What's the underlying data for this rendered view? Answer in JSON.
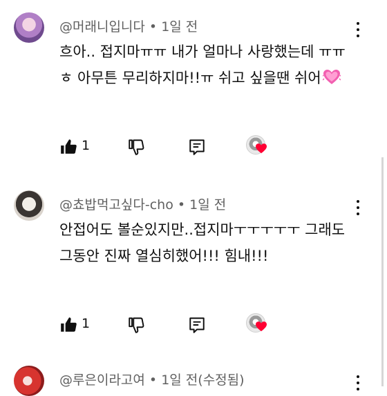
{
  "comments": [
    {
      "author": "@머래니입니다",
      "separator": " • ",
      "time": "1일 전",
      "text": "흐아.. 접지마ㅠㅠ 내가 얼마나 사랑했는데 ㅠㅠ ㅎ 아무튼 무리하지마!!ㅠ 쉬고 싶을땐 쉬어",
      "emoji": "pink-heart",
      "likes": "1"
    },
    {
      "author": "@쵸밥먹고싶다-cho",
      "separator": " • ",
      "time": "1일 전",
      "text": "안접어도 볼순있지만..접지마ㅜㅜㅜㅜㅜ 그래도 그동안 진짜 열심히했어!!! 힘내!!!",
      "likes": "1"
    },
    {
      "author": "@루은이라고여",
      "separator": " • ",
      "time": "1일 전(수정됨)"
    }
  ],
  "colors": {
    "text": "#0f0f0f",
    "meta": "#606060",
    "heart": "#ff0033"
  }
}
